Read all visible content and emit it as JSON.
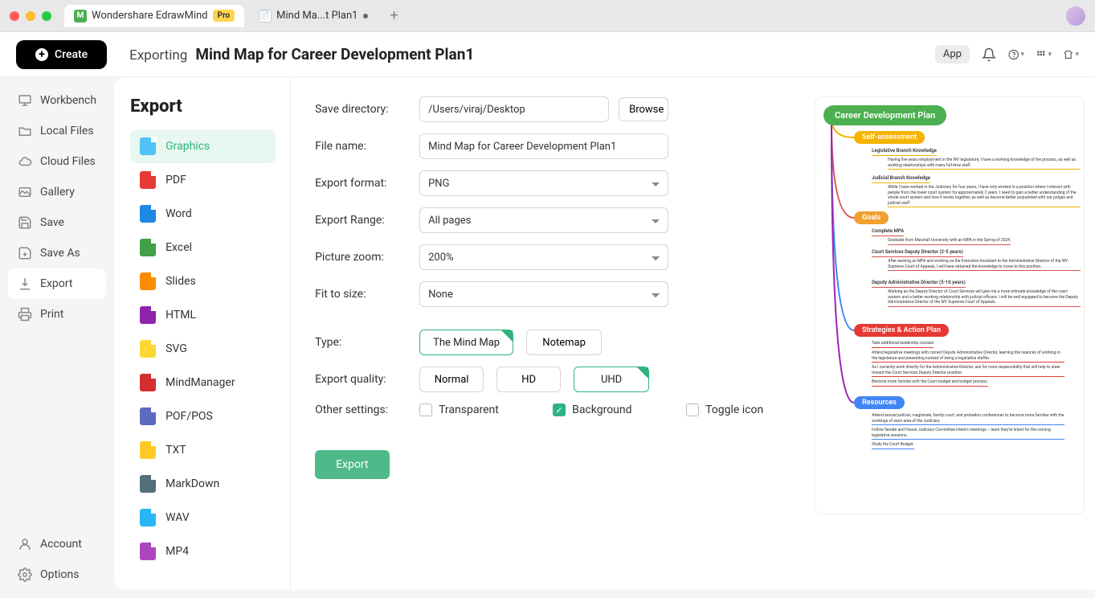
{
  "titlebar": {
    "active_tab": {
      "name": "Wondershare EdrawMind",
      "badge": "Pro"
    },
    "doc_tab": {
      "name": "Mind Ma...t Plan1"
    }
  },
  "header": {
    "create": "Create",
    "bc1": "Exporting",
    "bc2": "Mind Map for Career Development Plan1",
    "app": "App"
  },
  "sidebar": {
    "workbench": "Workbench",
    "localfiles": "Local Files",
    "cloudfiles": "Cloud Files",
    "gallery": "Gallery",
    "save": "Save",
    "saveas": "Save As",
    "export": "Export",
    "print": "Print",
    "account": "Account",
    "options": "Options"
  },
  "exportSide": {
    "title": "Export",
    "graphics": "Graphics",
    "pdf": "PDF",
    "word": "Word",
    "excel": "Excel",
    "slides": "Slides",
    "html": "HTML",
    "svg": "SVG",
    "mm": "MindManager",
    "pof": "POF/POS",
    "txt": "TXT",
    "md": "MarkDown",
    "wav": "WAV",
    "mp4": "MP4"
  },
  "form": {
    "save_dir_label": "Save directory:",
    "save_dir": "/Users/viraj/Desktop",
    "browse": "Browse",
    "file_name_label": "File name:",
    "file_name": "Mind Map for Career Development Plan1",
    "export_format_label": "Export format:",
    "export_format": "PNG",
    "export_range_label": "Export Range:",
    "export_range": "All pages",
    "picture_zoom_label": "Picture zoom:",
    "picture_zoom": "200%",
    "fit_label": "Fit to size:",
    "fit": "None",
    "type_label": "Type:",
    "type_mindmap": "The Mind Map",
    "type_notemap": "Notemap",
    "quality_label": "Export quality:",
    "q_normal": "Normal",
    "q_hd": "HD",
    "q_uhd": "UHD",
    "other_label": "Other settings:",
    "chk_transparent": "Transparent",
    "chk_background": "Background",
    "chk_toggle": "Toggle icon",
    "export_btn": "Export"
  },
  "preview": {
    "root": "Career Development Plan",
    "b1": "Self-assessment",
    "b1n1": "Legislative Branch Knowledge",
    "b1n1d": "Having five years employment in the WV legislature, I have a working knowledge of the process, as well as working relationships with many full-time staff.",
    "b1n2": "Judicial Branch Knowledge",
    "b1n2d": "While I have worked in the Judiciary for four years, I have only worked in a position where I interact with people from the lower court system for approximately 2 years. I need to gain a better understanding of the whole court system and how it works together, as well as become better acquainted with our judges and judicial staff.",
    "b2": "Goals",
    "b2n1": "Complete MPA",
    "b2n1d": "Graduate from Marshall University with an MPA in the Spring of 2024.",
    "b2n2": "Court Services Deputy Director (2-5 years)",
    "b2n2d": "After earning an MPA and working as the Executive Assistant to the Administrative Director of the WV Supreme Court of Appeals, I will have obtained the knowledge to move to this position.",
    "b2n3": "Deputy Administrative Director (5-10 years)",
    "b2n3d": "Working as the Deputy Director of Court Services will give me a more intimate knowledge of the court system and a better working relationship with judicial officers. I will be well equipped to become the Deputy Administrative Director of the WV Supreme Court of Appeals.",
    "b3": "Strategies & Action Plan",
    "b3n1": "Take additional leadership courses",
    "b3n2": "Attend legislative meetings with current Deputy Administrative Director, learning the nuances of working in the legislature and presenting instead of being a legislative staffer.",
    "b3n3": "As I currently work directly for the Administrative Director, ask for more responsibility that will help to steer toward the Court Services Deputy Director position.",
    "b3n4": "Become more familiar with the Court budget and budget process.",
    "b4": "Resources",
    "b4n1": "Attend annual judicial, magistrate, family court, and probation conferences to become more familiar with the workings of each area of the Judiciary.",
    "b4n2": "Follow Senate and House Judiciary Committee interim meetings – learn they're intent for the coming legislative sessions.",
    "b4n3": "Study the Court Budget."
  }
}
